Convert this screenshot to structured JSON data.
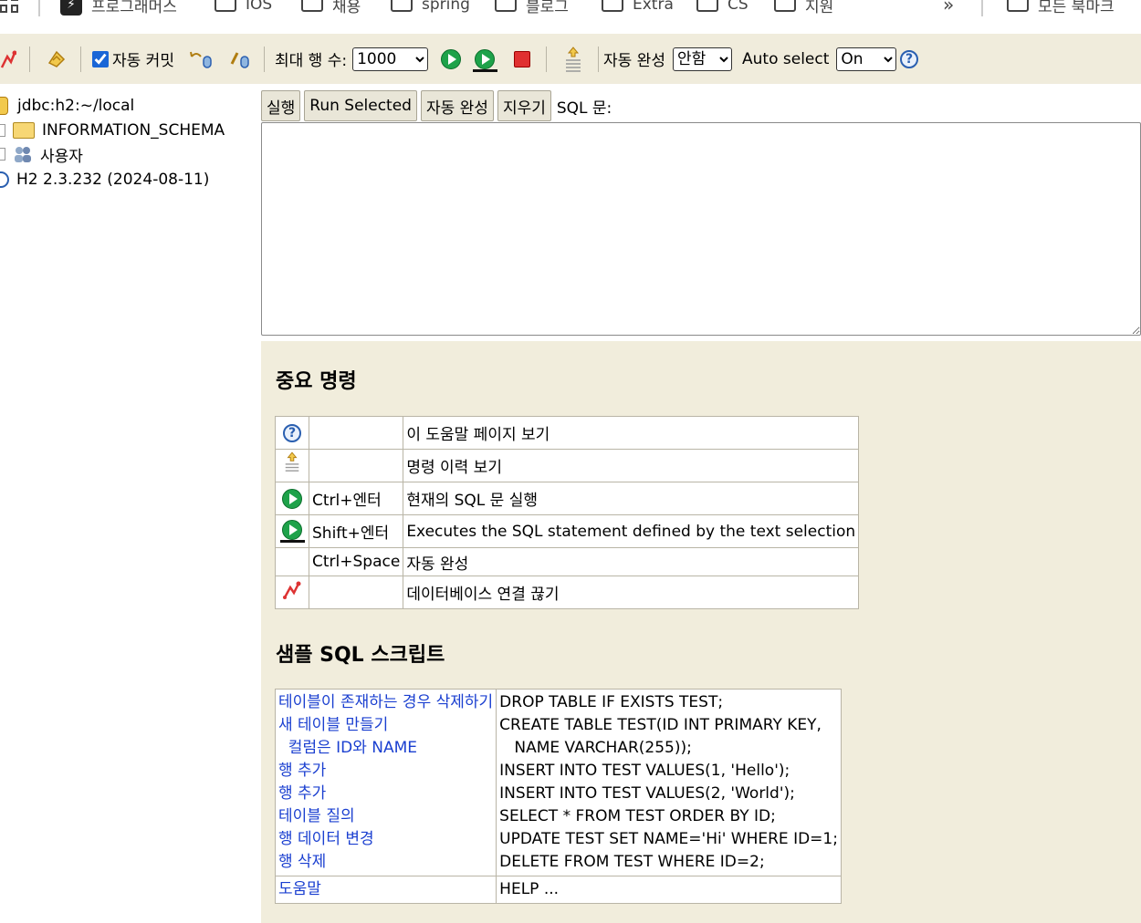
{
  "bookmarks": {
    "items": [
      {
        "label": "프로그래머스",
        "icon": "programmers-logo-icon"
      },
      {
        "label": "IOS",
        "icon": "folder-icon"
      },
      {
        "label": "채용",
        "icon": "folder-icon"
      },
      {
        "label": "spring",
        "icon": "folder-icon"
      },
      {
        "label": "블로그",
        "icon": "folder-icon"
      },
      {
        "label": "Extra",
        "icon": "folder-icon"
      },
      {
        "label": "CS",
        "icon": "folder-icon"
      },
      {
        "label": "지원",
        "icon": "folder-icon"
      }
    ],
    "overflow_label": "»",
    "all_bookmarks_label": "모든 북마크"
  },
  "toolbar": {
    "autocommit_label": "자동 커밋",
    "autocommit_checked": true,
    "max_rows_label": "최대 행 수:",
    "max_rows_value": "1000",
    "autocomplete_label": "자동 완성",
    "autocomplete_value": "안함",
    "auto_select_label": "Auto select",
    "auto_select_value": "On"
  },
  "tree": {
    "connection": "jdbc:h2:~/local",
    "schema": "INFORMATION_SCHEMA",
    "users": "사용자",
    "version": "H2 2.3.232 (2024-08-11)"
  },
  "query": {
    "run_label": "실행",
    "run_selected_label": "Run Selected",
    "autocomplete_label": "자동 완성",
    "clear_label": "지우기",
    "sql_label": "SQL 문:"
  },
  "help": {
    "important_title": "중요 명령",
    "commands": [
      {
        "icon": "help-icon",
        "key": "",
        "desc": "이 도움말 페이지 보기"
      },
      {
        "icon": "history-icon",
        "key": "",
        "desc": "명령 이력 보기"
      },
      {
        "icon": "run-icon",
        "key": "Ctrl+엔터",
        "desc": "현재의 SQL 문 실행"
      },
      {
        "icon": "run-selected-icon",
        "key": "Shift+엔터",
        "desc": "Executes the SQL statement defined by the text selection"
      },
      {
        "icon": "",
        "key": "Ctrl+Space",
        "desc": "자동 완성"
      },
      {
        "icon": "disconnect-icon",
        "key": "",
        "desc": "데이터베이스 연결 끊기"
      }
    ],
    "sample_title": "샘플 SQL 스크립트",
    "samples": [
      {
        "label": "테이블이 존재하는 경우 삭제하기",
        "sql": "DROP TABLE IF EXISTS TEST;"
      },
      {
        "label": "새 테이블 만들기",
        "sql": "CREATE TABLE TEST(ID INT PRIMARY KEY,"
      },
      {
        "label": "  컬럼은 ID와 NAME",
        "sql": "   NAME VARCHAR(255));"
      },
      {
        "label": "행 추가",
        "sql": "INSERT INTO TEST VALUES(1, 'Hello');"
      },
      {
        "label": "행 추가",
        "sql": "INSERT INTO TEST VALUES(2, 'World');"
      },
      {
        "label": "테이블 질의",
        "sql": "SELECT * FROM TEST ORDER BY ID;"
      },
      {
        "label": "행 데이터 변경",
        "sql": "UPDATE TEST SET NAME='Hi' WHERE ID=1;"
      },
      {
        "label": "행 삭제",
        "sql": "DELETE FROM TEST WHERE ID=2;"
      }
    ],
    "help_row": {
      "label": "도움말",
      "sql": "HELP ..."
    }
  }
}
